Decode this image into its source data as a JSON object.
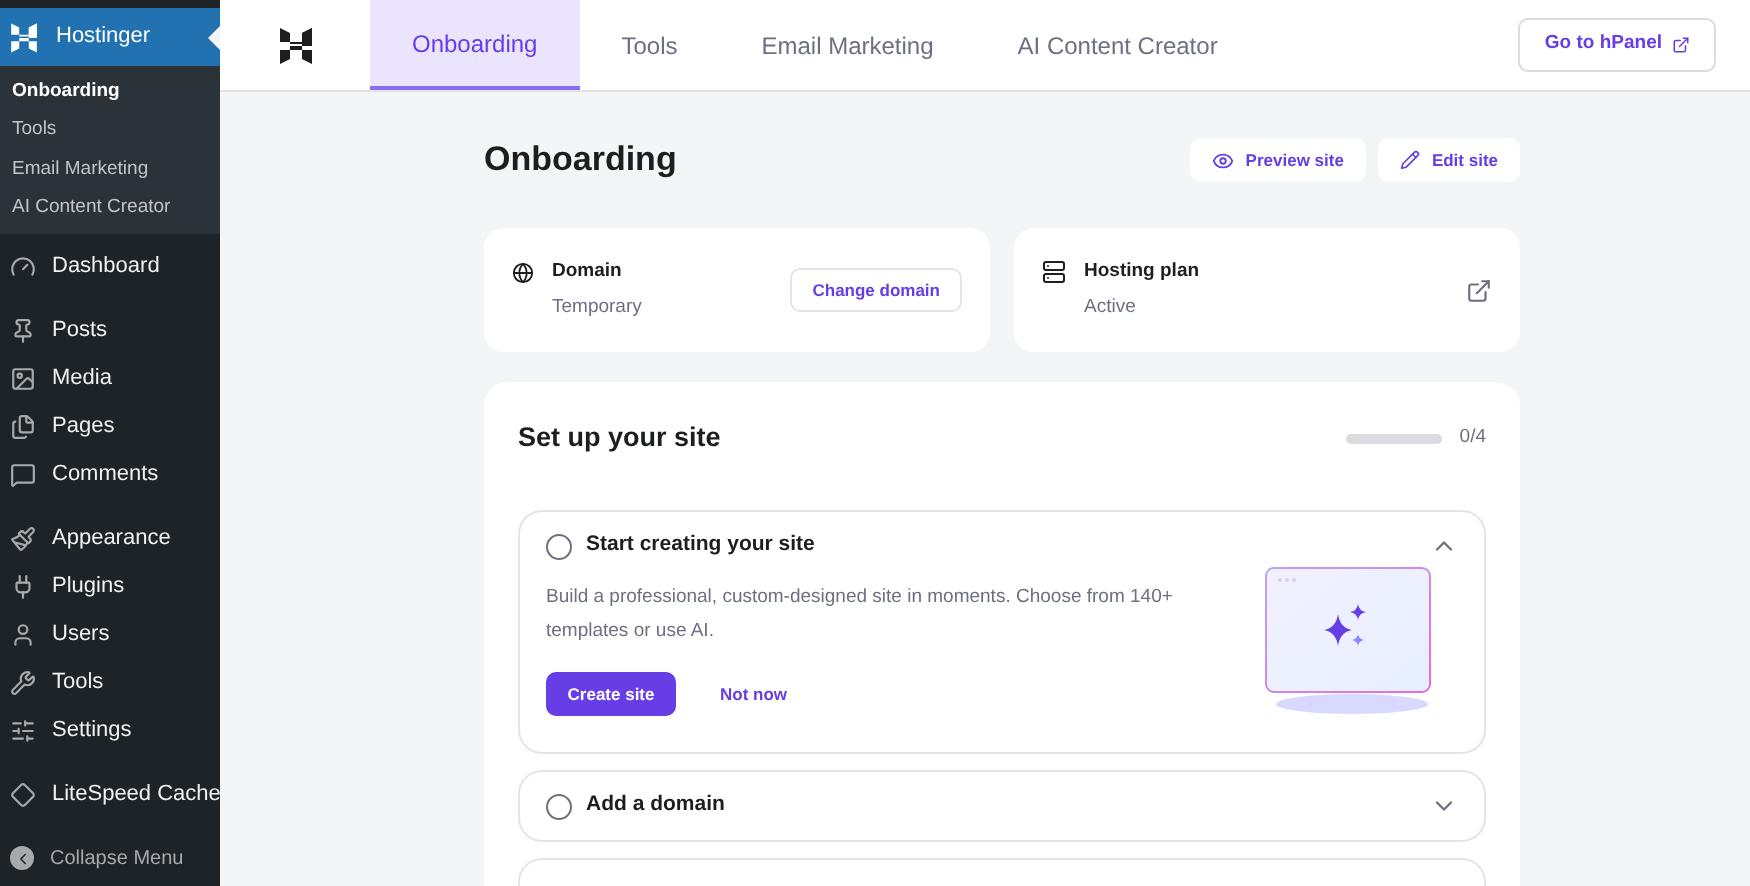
{
  "sidebar": {
    "header": {
      "label": "Hostinger",
      "selected": true
    },
    "submenu": [
      {
        "label": "Onboarding",
        "selected": true
      },
      {
        "label": "Tools",
        "selected": false
      },
      {
        "label": "Email Marketing",
        "selected": false
      },
      {
        "label": "AI Content Creator",
        "selected": false
      }
    ],
    "groups": [
      [
        "Dashboard"
      ],
      [
        "Posts",
        "Media",
        "Pages",
        "Comments"
      ],
      [
        "Appearance",
        "Plugins",
        "Users",
        "Tools",
        "Settings"
      ],
      [
        "LiteSpeed Cache"
      ]
    ],
    "collapse": "Collapse Menu"
  },
  "tabs": [
    {
      "label": "Onboarding",
      "selected": true
    },
    {
      "label": "Tools",
      "selected": false
    },
    {
      "label": "Email Marketing",
      "selected": false
    },
    {
      "label": "AI Content Creator",
      "selected": false
    }
  ],
  "hpanel_button": "Go to hPanel",
  "page_title": "Onboarding",
  "actions": [
    "Preview site",
    "Edit site"
  ],
  "domain_card": {
    "title": "Domain",
    "status": "Temporary",
    "button": "Change domain"
  },
  "hosting_card": {
    "title": "Hosting plan",
    "status": "Active"
  },
  "setup": {
    "heading": "Set up your site",
    "progress": {
      "level": 0,
      "reading": "0/4"
    },
    "tasks": [
      {
        "title": "Start creating your site",
        "checked": false,
        "expanded": true,
        "description": "Build a professional, custom-designed site in moments. Choose from 140+ templates or use AI.",
        "primary": "Create site",
        "secondary": "Not now"
      },
      {
        "title": "Add a domain",
        "checked": false,
        "expanded": false
      }
    ]
  }
}
